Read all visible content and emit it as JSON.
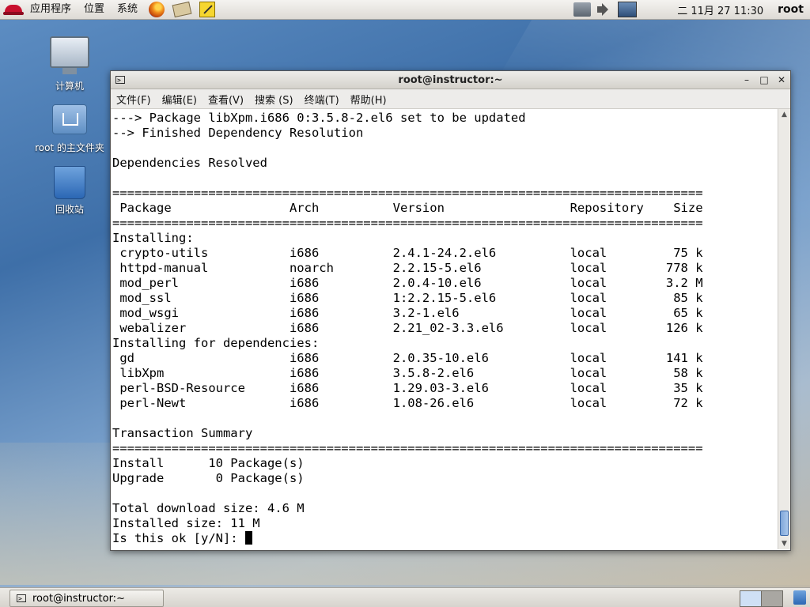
{
  "top_panel": {
    "menus": [
      "应用程序",
      "位置",
      "系统"
    ],
    "clock": "二 11月 27 11:30",
    "user": "root"
  },
  "desktop": {
    "icons": [
      {
        "label": "计算机",
        "icon": "computer-icon"
      },
      {
        "label": "root 的主文件夹",
        "icon": "home-folder-icon"
      },
      {
        "label": "回收站",
        "icon": "trash-icon"
      }
    ]
  },
  "window": {
    "title": "root@instructor:~",
    "controls": {
      "minimize": "–",
      "maximize": "□",
      "close": "✕"
    },
    "menus": [
      "文件(F)",
      "编辑(E)",
      "查看(V)",
      "搜索 (S)",
      "终端(T)",
      "帮助(H)"
    ]
  },
  "terminal": {
    "lines": [
      "---> Package libXpm.i686 0:3.5.8-2.el6 set to be updated",
      "--> Finished Dependency Resolution",
      "",
      "Dependencies Resolved",
      "",
      "================================================================================",
      " Package                Arch          Version                 Repository    Size",
      "================================================================================",
      "Installing:",
      " crypto-utils           i686          2.4.1-24.2.el6          local         75 k",
      " httpd-manual           noarch        2.2.15-5.el6            local        778 k",
      " mod_perl               i686          2.0.4-10.el6            local        3.2 M",
      " mod_ssl                i686          1:2.2.15-5.el6          local         85 k",
      " mod_wsgi               i686          3.2-1.el6               local         65 k",
      " webalizer              i686          2.21_02-3.3.el6         local        126 k",
      "Installing for dependencies:",
      " gd                     i686          2.0.35-10.el6           local        141 k",
      " libXpm                 i686          3.5.8-2.el6             local         58 k",
      " perl-BSD-Resource      i686          1.29.03-3.el6           local         35 k",
      " perl-Newt              i686          1.08-26.el6             local         72 k",
      "",
      "Transaction Summary",
      "================================================================================",
      "Install      10 Package(s)",
      "Upgrade       0 Package(s)",
      "",
      "Total download size: 4.6 M",
      "Installed size: 11 M"
    ],
    "prompt": "Is this ok [y/N]: "
  },
  "taskbar": {
    "task_label": "root@instructor:~"
  }
}
